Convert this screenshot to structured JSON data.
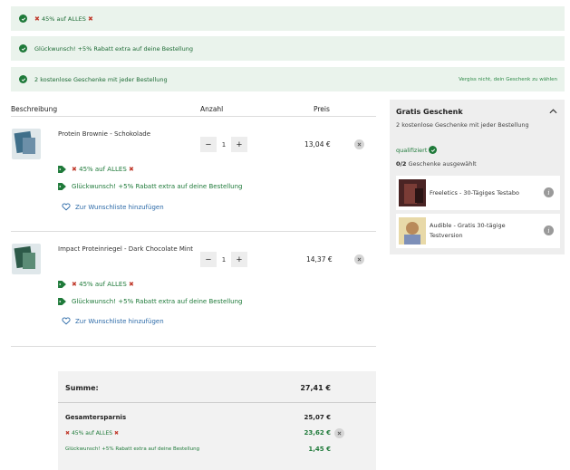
{
  "banners": [
    {
      "text": "45% auf ALLES",
      "extra": ""
    },
    {
      "text": "Glückwunsch! +5% Rabatt extra auf deine Bestellung",
      "extra": ""
    },
    {
      "text": "2 kostenlose Geschenke mit jeder Bestellung",
      "extra": "Vergiss nicht, dein Geschenk zu wählen"
    }
  ],
  "table": {
    "headers": {
      "description": "Beschreibung",
      "quantity": "Anzahl",
      "price": "Preis"
    }
  },
  "items": [
    {
      "name": "Protein Brownie - Schokolade",
      "quantity": "1",
      "price": "13,04 €",
      "promos": [
        "45% auf ALLES",
        "Glückwunsch! +5% Rabatt extra auf deine Bestellung"
      ],
      "wishlist": "Zur Wunschliste hinzufügen"
    },
    {
      "name": "Impact Proteinriegel - Dark Chocolate Mint",
      "quantity": "1",
      "price": "14,37 €",
      "promos": [
        "45% auf ALLES",
        "Glückwunsch! +5% Rabatt extra auf deine Bestellung"
      ],
      "wishlist": "Zur Wunschliste hinzufügen"
    }
  ],
  "qty_buttons": {
    "minus": "−",
    "plus": "+"
  },
  "summary": {
    "total_label": "Summe:",
    "total_value": "27,41 €",
    "savings_label": "Gesamtersparnis",
    "savings_value": "25,07 €",
    "discounts": [
      {
        "label": "45% auf ALLES",
        "value": "23,62 €"
      },
      {
        "label": "Glückwunsch! +5% Rabatt extra auf deine Bestellung",
        "value": "1,45 €"
      }
    ]
  },
  "gifts": {
    "title": "Gratis Geschenk",
    "subtitle": "2 kostenlose Geschenke mit jeder Bestellung",
    "qualified": "qualifiziert",
    "selected_count": "0/2",
    "selected_text": "Geschenke ausgewählt",
    "options": [
      {
        "name": "Freeletics - 30-Tägiges Testabo",
        "icon": "freeletics-logo"
      },
      {
        "name": "Audible - Gratis 30-tägige Testversion",
        "icon": "audible-cover"
      }
    ]
  },
  "colors": {
    "accent_green": "#1f7a3a",
    "banner_bg": "#eaf3ec",
    "link_blue": "#2c6aa8"
  }
}
